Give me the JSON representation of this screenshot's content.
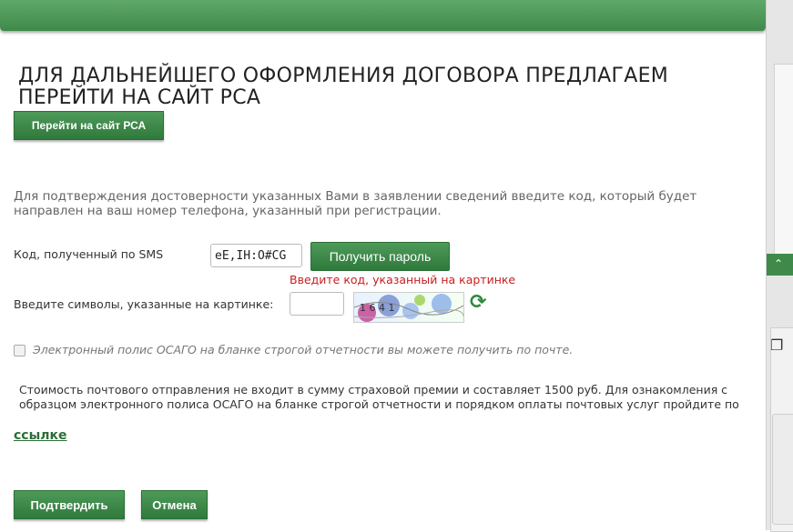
{
  "header": {
    "title": "ДЛЯ ДАЛЬНЕЙШЕГО ОФОРМЛЕНИЯ ДОГОВОРА ПРЕДЛАГАЕМ ПЕРЕЙТИ НА САЙТ РСА"
  },
  "rsa_button_label": "Перейти на сайт РСА",
  "info_text": "Для подтверждения достоверности указанных Вами в заявлении сведений введите код, который будет направлен на ваш номер телефона, указанный при регистрации.",
  "sms": {
    "label": "Код, полученный по SMS",
    "value": "eE,IH:O#CG",
    "get_password_label": "Получить пароль"
  },
  "captcha": {
    "error": "Введите код, указанный на картинке",
    "label": "Введите символы, указанные на картинке:",
    "value": "",
    "image_text": "1 6 4 1"
  },
  "postal_checkbox": {
    "label": "Электронный полис ОСАГО на бланке строгой отчетности вы можете получить по почте.",
    "checked": false
  },
  "note": "Стоимость почтового отправления не входит в сумму страховой премии и составляет 1500 руб. Для ознакомления с образцом электронного полиса ОСАГО на бланке строгой отчетности и порядком оплаты почтовых услуг пройдите по",
  "link_label": "ссылке",
  "actions": {
    "confirm_label": "Подтвердить",
    "cancel_label": "Отмена"
  },
  "colors": {
    "accent": "#3f8a4a",
    "error": "#c81e1e"
  },
  "icons": {
    "refresh": "refresh-icon",
    "restore": "restore-window-icon"
  }
}
